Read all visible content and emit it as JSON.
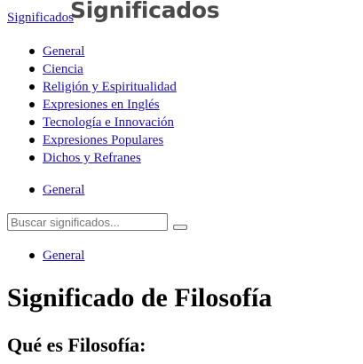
{
  "header": {
    "site_link": "Significados",
    "logo_text": "Significados"
  },
  "nav_main": {
    "items": [
      {
        "label": "General"
      },
      {
        "label": "Ciencia"
      },
      {
        "label": "Religión y Espiritualidad"
      },
      {
        "label": "Expresiones en Inglés"
      },
      {
        "label": "Tecnología e Innovación"
      },
      {
        "label": "Expresiones Populares"
      },
      {
        "label": "Dichos y Refranes"
      }
    ]
  },
  "nav_second": {
    "items": [
      {
        "label": "General"
      }
    ]
  },
  "search": {
    "placeholder": "Buscar significados..."
  },
  "nav_third": {
    "items": [
      {
        "label": "General"
      }
    ]
  },
  "main": {
    "title": "Significado de Filosofía",
    "subtitle": "Qué es Filosofía:"
  },
  "colors": {
    "link": "#1a0dab",
    "logo": "#4a4a4a"
  }
}
